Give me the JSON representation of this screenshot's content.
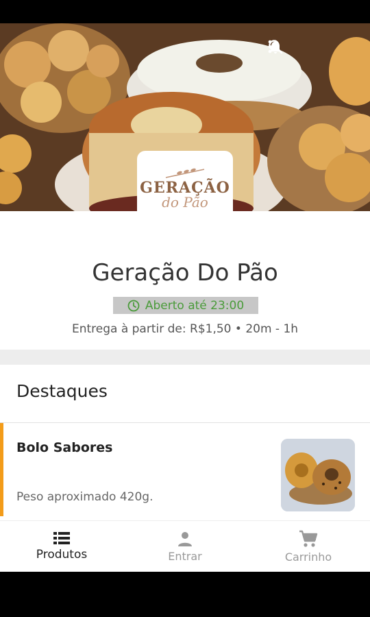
{
  "store": {
    "name": "Geração Do Pão",
    "logo_line1": "GERAÇÃO",
    "logo_line2": "do Pão",
    "status": "Aberto até 23:00",
    "delivery": "Entrega à partir de: R$1,50 • 20m - 1h"
  },
  "colors": {
    "accent": "#f39c1a",
    "open_green": "#4a9b3a",
    "badge_bg": "#c7c7c7",
    "logo_brown": "#8c6243"
  },
  "top_actions": [
    "bell-icon",
    "search-icon",
    "more-vert-icon"
  ],
  "section": {
    "title": "Destaques"
  },
  "product": {
    "name": "Bolo Sabores",
    "description": "Peso aproximado 420g."
  },
  "bottom_nav": {
    "items": [
      {
        "label": "Produtos",
        "icon": "list-icon",
        "active": true
      },
      {
        "label": "Entrar",
        "icon": "person-icon",
        "active": false
      },
      {
        "label": "Carrinho",
        "icon": "cart-icon",
        "active": false
      }
    ]
  }
}
